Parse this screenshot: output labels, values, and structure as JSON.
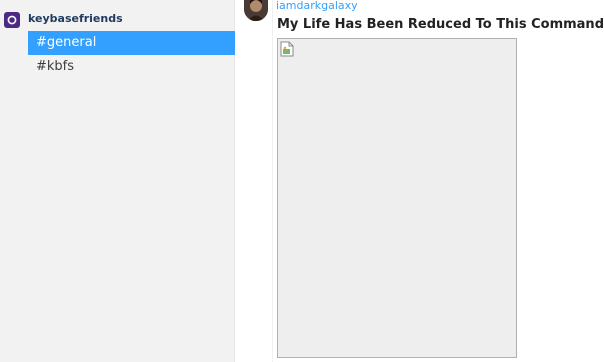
{
  "sidebar": {
    "team": {
      "name": "keybasefriends",
      "avatar_color": "#4c2a84"
    },
    "channels": [
      {
        "label": "#general",
        "active": true
      },
      {
        "label": "#kbfs",
        "active": false
      }
    ]
  },
  "conversation": {
    "messages": [
      {
        "author": "iamdarkgalaxy",
        "text": "My Life Has Been Reduced To This Command",
        "attachment": {
          "type": "image",
          "state": "broken-image-icon"
        }
      }
    ]
  },
  "colors": {
    "accent": "#33a0ff",
    "sidebar_bg": "#f2f2f2",
    "team_avatar": "#4c2a84"
  }
}
